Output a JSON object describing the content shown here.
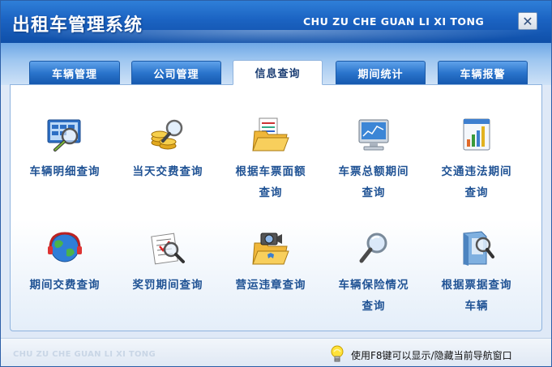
{
  "window": {
    "title": "出租车管理系统",
    "pinyin_header": "CHU ZU CHE GUAN LI XI TONG",
    "close_label": "✕"
  },
  "tabs": [
    {
      "label": "车辆管理",
      "active": false
    },
    {
      "label": "公司管理",
      "active": false
    },
    {
      "label": "信息查询",
      "active": true
    },
    {
      "label": "期间统计",
      "active": false
    },
    {
      "label": "车辆报警",
      "active": false
    }
  ],
  "items": [
    {
      "line1": "车辆明细查询",
      "line2": "",
      "icon": "vehicle-detail-icon"
    },
    {
      "line1": "当天交费查询",
      "line2": "",
      "icon": "coins-magnifier-icon"
    },
    {
      "line1": "根据车票面额",
      "line2": "查询",
      "icon": "folder-documents-icon"
    },
    {
      "line1": "车票总额期间",
      "line2": "查询",
      "icon": "monitor-chart-icon"
    },
    {
      "line1": "交通违法期间",
      "line2": "查询",
      "icon": "calendar-chart-icon"
    },
    {
      "line1": "期间交费查询",
      "line2": "",
      "icon": "globe-headset-icon"
    },
    {
      "line1": "奖罚期间查询",
      "line2": "",
      "icon": "checklist-magnifier-icon"
    },
    {
      "line1": "营运违章查询",
      "line2": "",
      "icon": "folder-camera-icon"
    },
    {
      "line1": "车辆保险情况",
      "line2": "查询",
      "icon": "magnifier-icon"
    },
    {
      "line1": "根据票据查询",
      "line2": "车辆",
      "icon": "book-magnifier-icon"
    }
  ],
  "footer": {
    "pinyin": "CHU ZU CHE GUAN LI XI TONG",
    "tip": "使用F8键可以显示/隐藏当前导航窗口",
    "tip_icon": "lightbulb-icon"
  }
}
